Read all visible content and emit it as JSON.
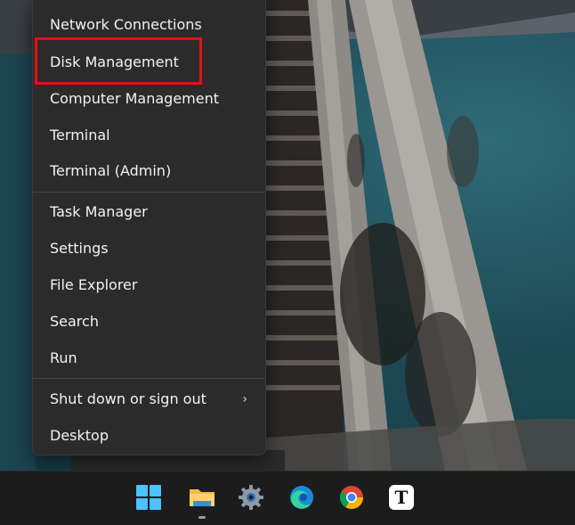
{
  "menu": {
    "items": [
      {
        "label": "Network Connections"
      },
      {
        "label": "Disk Management",
        "highlighted": true
      },
      {
        "label": "Computer Management"
      },
      {
        "label": "Terminal"
      },
      {
        "label": "Terminal (Admin)"
      },
      {
        "label": "Task Manager"
      },
      {
        "label": "Settings"
      },
      {
        "label": "File Explorer"
      },
      {
        "label": "Search"
      },
      {
        "label": "Run"
      },
      {
        "label": "Shut down or sign out",
        "submenu": true
      },
      {
        "label": "Desktop"
      }
    ],
    "submenu_arrow": "›"
  },
  "taskbar": {
    "icons": [
      {
        "name": "windows-start-icon"
      },
      {
        "name": "file-explorer-icon",
        "active": true
      },
      {
        "name": "settings-gear-icon"
      },
      {
        "name": "edge-browser-icon"
      },
      {
        "name": "chrome-browser-icon"
      },
      {
        "name": "typora-app-icon",
        "glyph": "T"
      }
    ]
  },
  "colors": {
    "menu_bg": "#2b2b2b",
    "menu_text": "#f2f2f2",
    "highlight_border": "#e01212",
    "taskbar_bg": "#1c1c1c"
  }
}
